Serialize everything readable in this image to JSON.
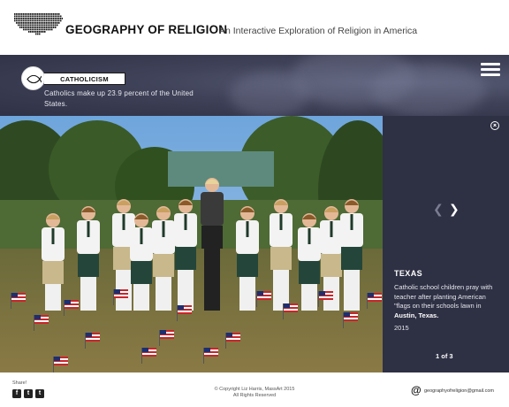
{
  "header": {
    "title": "GEOGRAPHY OF RELIGION",
    "subtitle": "An Interactive Exploration of Religion in America",
    "logo_icon": "usa-dotted-map-icon"
  },
  "category": {
    "label": "CATHOLICISM",
    "icon": "ichthys-fish-icon",
    "fact": "Catholics make up 23.9 percent of the United States."
  },
  "menu": {
    "icon": "hamburger-menu-icon"
  },
  "slide": {
    "title": "TEXAS",
    "caption_before": "Catholic school children pray with teacher after planting American \"flags on their schools lawn in ",
    "caption_place": "Austin, Texas.",
    "year": "2015",
    "counter": "1 of 3",
    "prev_icon": "chevron-left-icon",
    "next_icon": "chevron-right-icon",
    "close_icon": "close-circle-icon"
  },
  "footer": {
    "share_label": "Share!",
    "social": [
      {
        "name": "facebook-icon",
        "glyph": "f"
      },
      {
        "name": "tumblr-icon",
        "glyph": "t"
      },
      {
        "name": "twitter-icon",
        "glyph": "t"
      }
    ],
    "copyright_line1": "© Copyright Liz Harris, MassArt 2015",
    "copyright_line2": "All Rights Reserved",
    "email": "geographyofreligion@gmail.com"
  },
  "colors": {
    "band": "#3f4258",
    "panel": "#2e3044",
    "accent_text": "#ffffff"
  }
}
